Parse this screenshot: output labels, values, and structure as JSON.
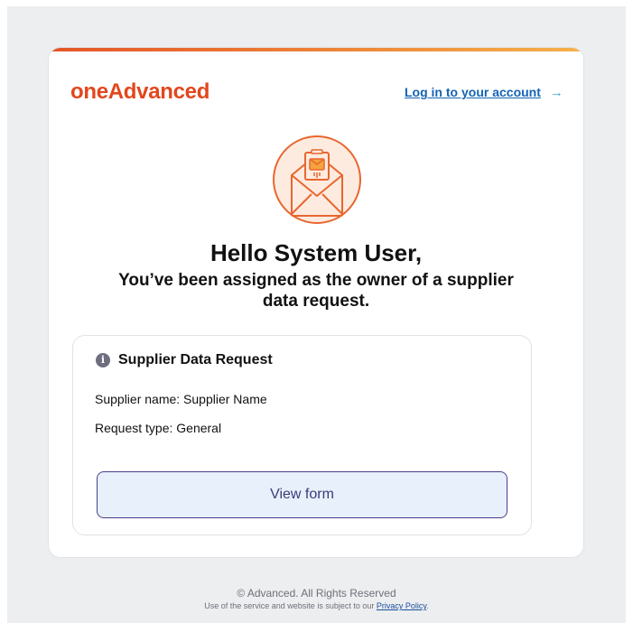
{
  "header": {
    "logo_text": "oneAdvanced",
    "login_link_label": "Log in to your account",
    "brand_color": "#e2461c"
  },
  "message": {
    "greeting": "Hello System User,",
    "subtitle_line1": "You’ve been assigned as the owner of a supplier",
    "subtitle_line2": "data request."
  },
  "request_card": {
    "title": "Supplier Data Request",
    "supplier_name": "Supplier name: Supplier Name",
    "request_type": "Request type: General",
    "view_button_label": "View form"
  },
  "footer": {
    "copyright": "© Advanced. All Rights Reserved",
    "terms_prefix": "Use of the service and website is subject to our ",
    "privacy_link": "Privacy Policy",
    "terms_suffix": "."
  },
  "icons": {
    "hero": "envelope-icon",
    "info": "info-icon",
    "arrow": "arrow-right-icon"
  }
}
